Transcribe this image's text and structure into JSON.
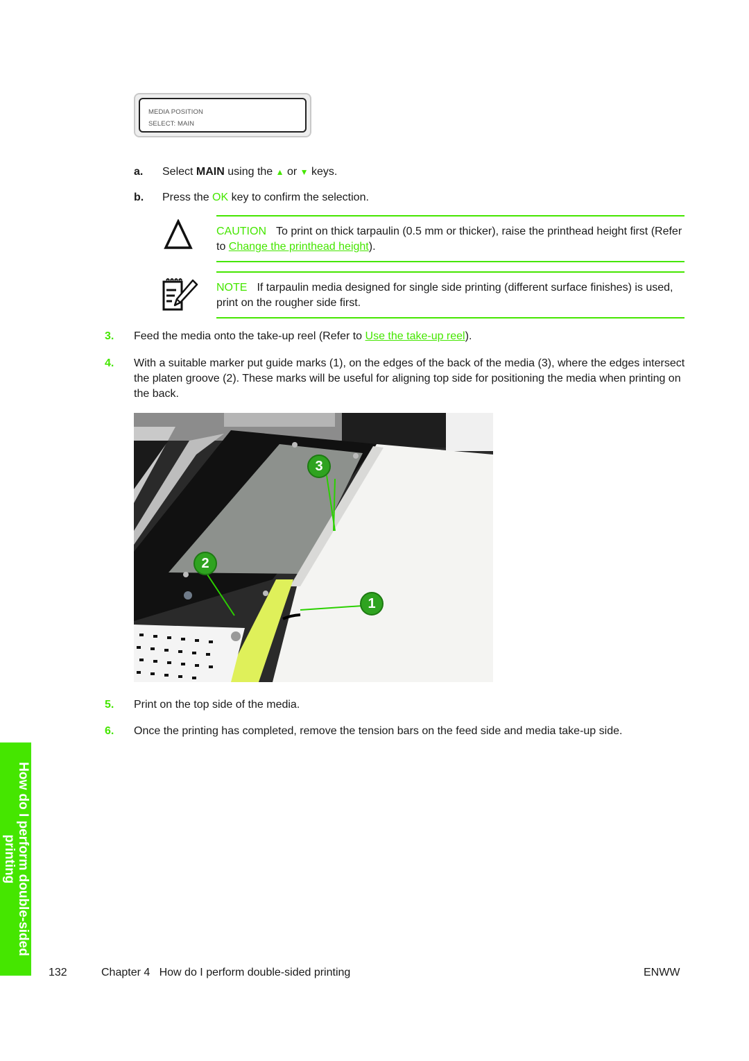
{
  "lcd": {
    "line1": "MEDIA POSITION",
    "line2": "SELECT: MAIN"
  },
  "substeps": [
    {
      "label": "a.",
      "text_before": "Select ",
      "bold": "MAIN",
      "text_mid": " using the ",
      "up_icon": "▲",
      "text_or": " or ",
      "down_icon": "▼",
      "text_after": " keys."
    },
    {
      "label": "b.",
      "text_before": "Press the ",
      "key": "OK",
      "text_after": " key to confirm the selection."
    }
  ],
  "caution": {
    "keyword": "CAUTION",
    "text": "To print on thick tarpaulin (0.5 mm or thicker), raise the printhead height first (Refer to ",
    "link": "Change the printhead height",
    "text_after": ")."
  },
  "note": {
    "keyword": "NOTE",
    "text": "If tarpaulin media designed for single side printing (different surface finishes) is used, print on the rougher side first."
  },
  "steps": [
    {
      "num": "3.",
      "text": "Feed the media onto the take-up reel (Refer to ",
      "link": "Use the take-up reel",
      "text_after": ")."
    },
    {
      "num": "4.",
      "text": "With a suitable marker put guide marks (1), on the edges of the back of the media (3), where the edges intersect the platen groove (2). These marks will be useful for aligning top side for positioning the media when printing on the back."
    },
    {
      "num": "5.",
      "text": "Print on the top side of the media."
    },
    {
      "num": "6.",
      "text": "Once the printing has completed, remove the tension bars on the feed side and media take-up side."
    }
  ],
  "photo": {
    "callouts": [
      "1",
      "2",
      "3"
    ]
  },
  "side_tab": {
    "line1": "How do I perform double-sided",
    "line2": "printing"
  },
  "footer": {
    "page_number": "132",
    "chapter": "Chapter 4   How do I perform double-sided printing",
    "locale": "ENWW"
  },
  "colors": {
    "accent_green": "#45e600",
    "text": "#1a1a1a"
  }
}
